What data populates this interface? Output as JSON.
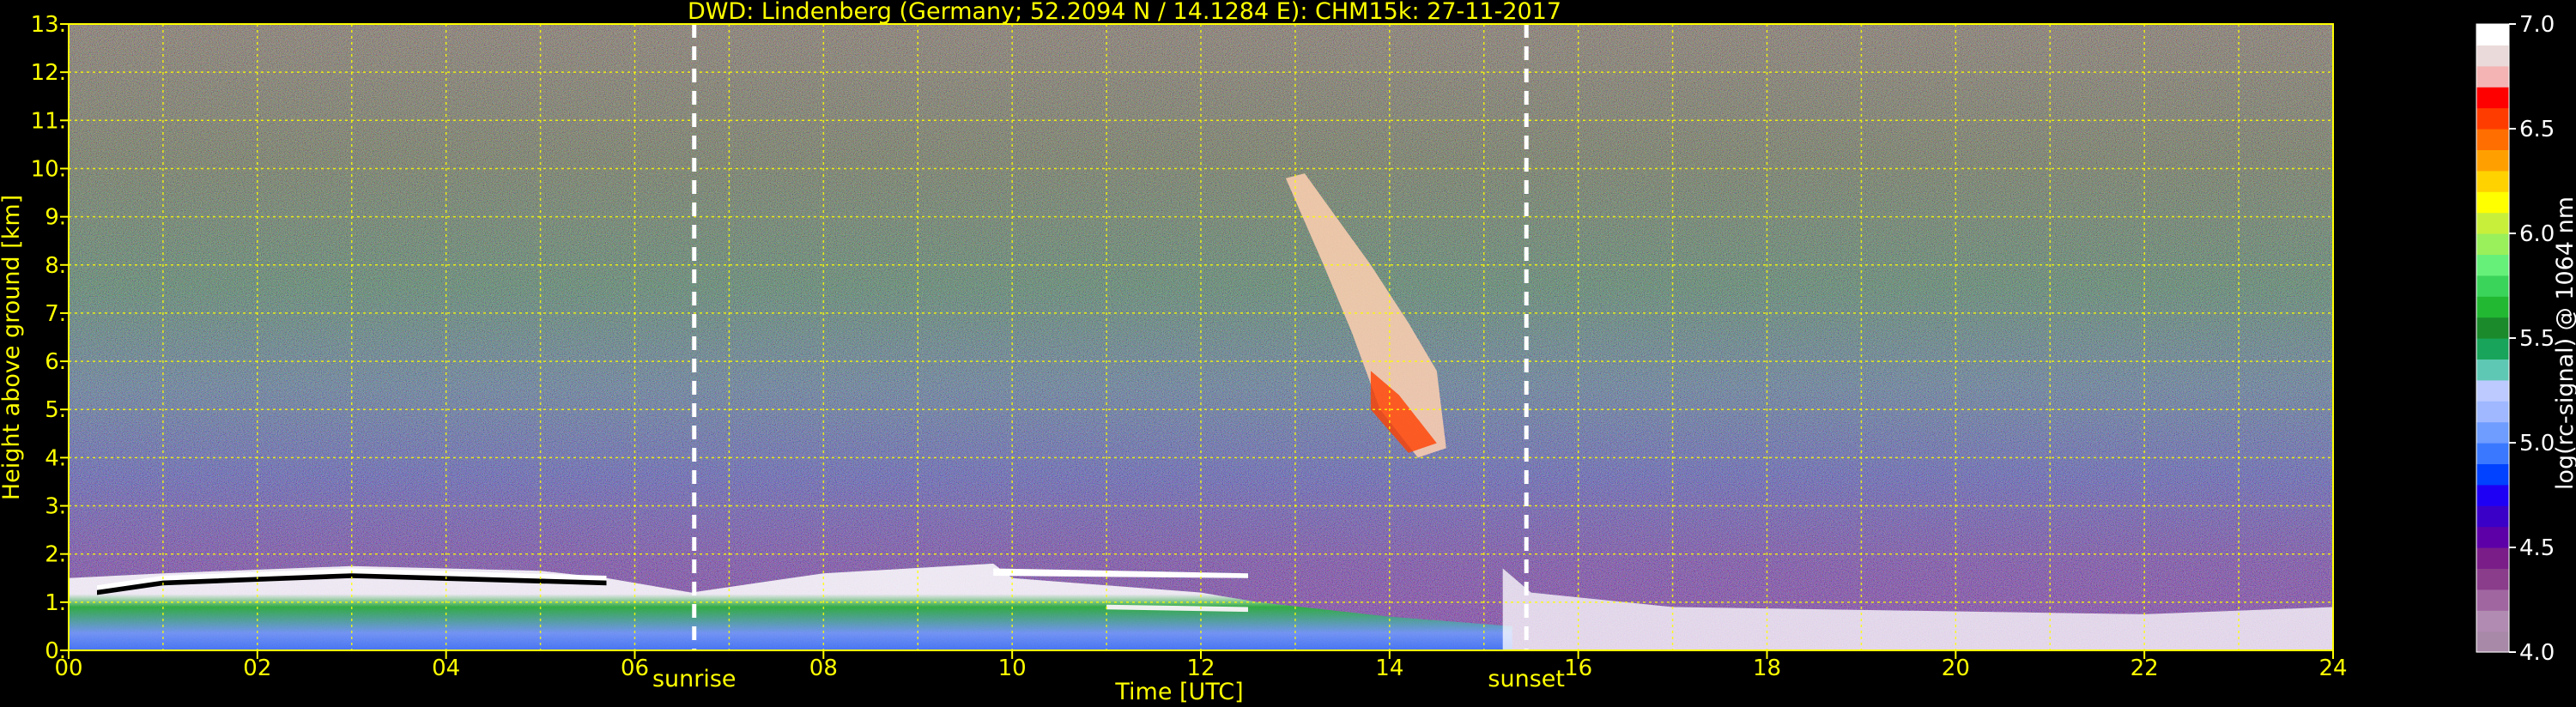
{
  "chart_data": {
    "type": "heatmap",
    "title": "DWD: Lindenberg (Germany; 52.2094 N / 14.1284 E):    CHM15k: 27-11-2017",
    "xlabel": "Time [UTC]",
    "ylabel": "Height above ground [km]",
    "xlim": [
      0,
      24
    ],
    "ylim": [
      0,
      13
    ],
    "x_ticks": [
      "00",
      "02",
      "04",
      "06",
      "08",
      "10",
      "12",
      "14",
      "16",
      "18",
      "20",
      "22",
      "24"
    ],
    "y_ticks": [
      "0.",
      "1.",
      "2.",
      "3.",
      "4.",
      "5.",
      "6.",
      "7.",
      "8.",
      "9.",
      "10.",
      "11.",
      "12.",
      "13."
    ],
    "grid": true,
    "colorbar": {
      "label": "log(rc-signal) @ 1064 nm",
      "range": [
        4.0,
        7.0
      ],
      "ticks": [
        "4.0",
        "4.5",
        "5.0",
        "5.5",
        "6.0",
        "6.5",
        "7.0"
      ],
      "colors": [
        "#a88aa8",
        "#b18bb1",
        "#a066a0",
        "#8a3d8a",
        "#7a1d88",
        "#5e00a8",
        "#3a00c8",
        "#1e00f5",
        "#0042ff",
        "#3a78ff",
        "#6e9cff",
        "#9fb8ff",
        "#bccaff",
        "#5fc8b4",
        "#18a45a",
        "#1a8a2a",
        "#22b832",
        "#3bd45a",
        "#66f07a",
        "#9af05a",
        "#c8f03a",
        "#ffff00",
        "#ffd200",
        "#ffa000",
        "#ff6e00",
        "#ff3c00",
        "#ff0000",
        "#f4b4b4",
        "#eadada",
        "#ffffff"
      ]
    },
    "annotations": [
      {
        "label": "sunrise",
        "x": 6.63
      },
      {
        "label": "sunset",
        "x": 15.45
      }
    ]
  }
}
